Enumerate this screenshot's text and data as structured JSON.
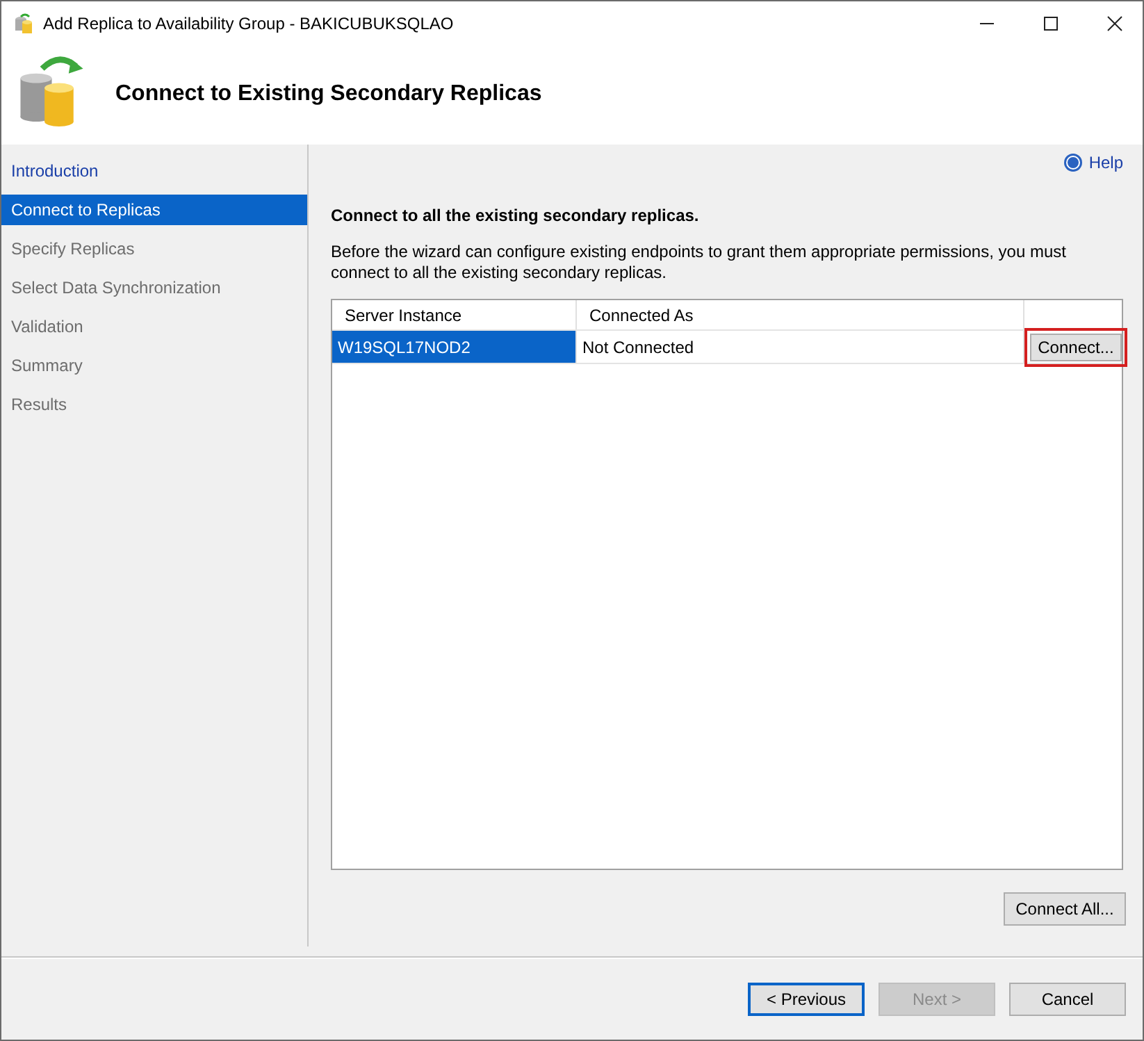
{
  "window": {
    "title": "Add Replica to Availability Group - BAKICUBUKSQLAO"
  },
  "header": {
    "title": "Connect to Existing Secondary Replicas"
  },
  "steps": [
    {
      "label": "Introduction",
      "selected": false,
      "enabled": true
    },
    {
      "label": "Connect to Replicas",
      "selected": true,
      "enabled": true
    },
    {
      "label": "Specify Replicas",
      "selected": false,
      "enabled": false
    },
    {
      "label": "Select Data Synchronization",
      "selected": false,
      "enabled": false
    },
    {
      "label": "Validation",
      "selected": false,
      "enabled": false
    },
    {
      "label": "Summary",
      "selected": false,
      "enabled": false
    },
    {
      "label": "Results",
      "selected": false,
      "enabled": false
    }
  ],
  "help": "Help",
  "heading": "Connect to all the existing secondary replicas.",
  "description": "Before the wizard can configure existing endpoints to grant them appropriate permissions, you must connect to all the existing secondary replicas.",
  "table": {
    "columns": [
      "Server Instance",
      "Connected As"
    ],
    "rows": [
      {
        "server_instance": "W19SQL17NOD2",
        "connected_as": "Not Connected",
        "selected": true,
        "action": "Connect...",
        "highlighted": true
      }
    ]
  },
  "connect_all": "Connect All...",
  "buttons": [
    {
      "label": "< Previous",
      "disabled": false,
      "focused": true
    },
    {
      "label": "Next >",
      "disabled": true,
      "focused": false
    },
    {
      "label": "Cancel",
      "disabled": false,
      "focused": false
    }
  ]
}
